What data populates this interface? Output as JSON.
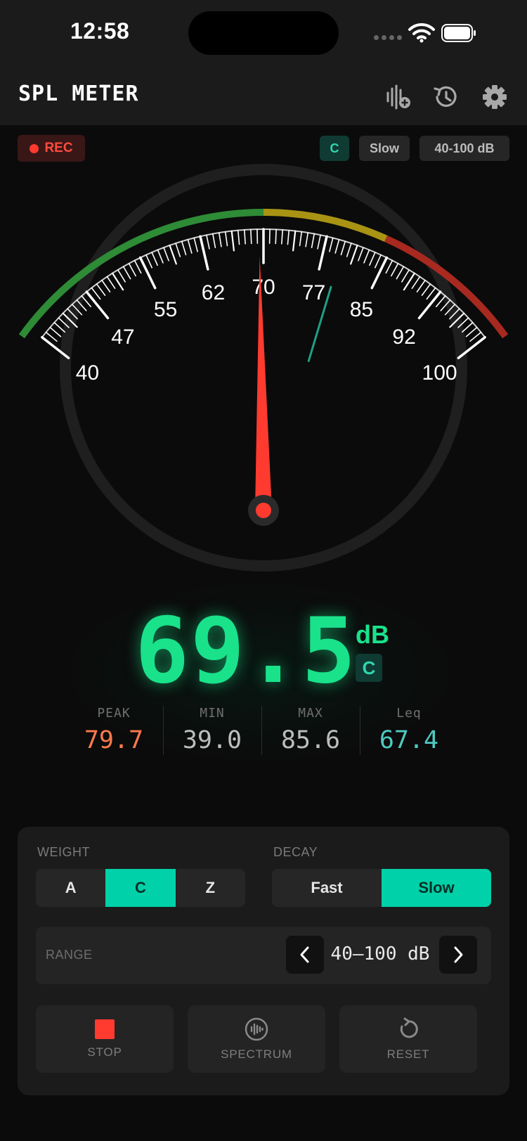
{
  "status_bar": {
    "time": "12:58"
  },
  "header": {
    "title": "SPL METER",
    "icons": [
      "waveform-add-icon",
      "history-icon",
      "gear-icon"
    ]
  },
  "status_chips": {
    "rec": "REC",
    "weighting": "C",
    "response": "Slow",
    "range": "40-100 dB"
  },
  "gauge": {
    "range": [
      40,
      100
    ],
    "tick_labels": [
      "40",
      "47",
      "55",
      "62",
      "70",
      "77",
      "85",
      "92",
      "100"
    ],
    "needle_value": 69.5,
    "peak_value": 79.7,
    "colors": {
      "green": "#2e8b36",
      "yellow": "#a99313",
      "red": "#a8291f",
      "needle": "#ff3b30",
      "peak_marker": "#1fa085"
    }
  },
  "readout": {
    "value": "69.5",
    "unit": "dB",
    "weighting": "C",
    "stats": [
      {
        "label": "PEAK",
        "value": "79.7",
        "color": "#ff7a4d"
      },
      {
        "label": "MIN",
        "value": "39.0",
        "color": "#bdbdbd"
      },
      {
        "label": "MAX",
        "value": "85.6",
        "color": "#bdbdbd"
      },
      {
        "label": "Leq",
        "value": "67.4",
        "color": "#4ec9c0"
      }
    ]
  },
  "controls": {
    "weight_label": "WEIGHT",
    "weight_options": [
      "A",
      "C",
      "Z"
    ],
    "weight_selected": "C",
    "decay_label": "DECAY",
    "decay_options": [
      "Fast",
      "Slow"
    ],
    "decay_selected": "Slow",
    "range_label": "RANGE",
    "range_value": "40–100 dB",
    "actions": [
      {
        "label": "STOP",
        "icon": "stop-icon"
      },
      {
        "label": "SPECTRUM",
        "icon": "spectrum-icon"
      },
      {
        "label": "RESET",
        "icon": "reset-icon"
      }
    ]
  },
  "accent": "#00d1a8"
}
